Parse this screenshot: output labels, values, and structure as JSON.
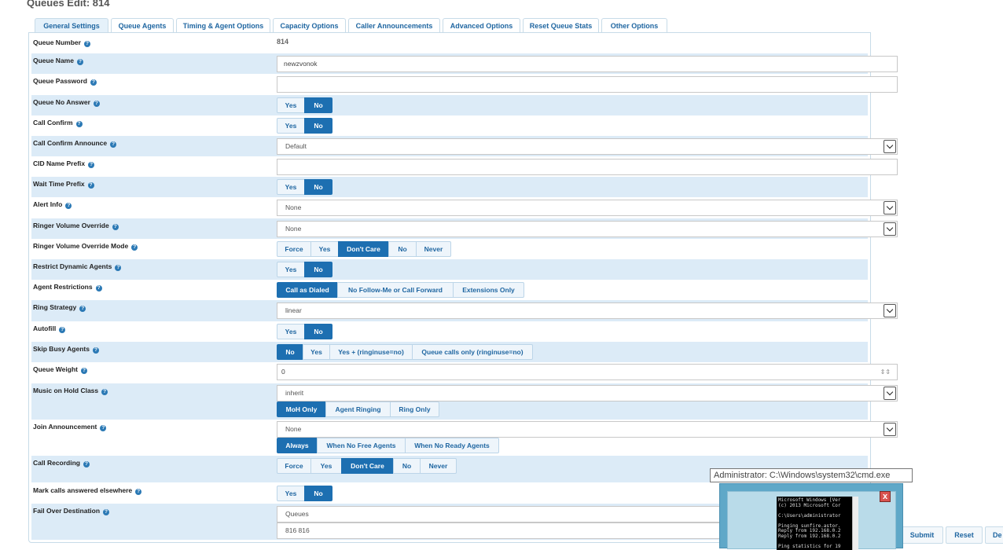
{
  "page": {
    "title": "Queues Edit: 814"
  },
  "tabs": [
    "General Settings",
    "Queue Agents",
    "Timing & Agent Options",
    "Capacity Options",
    "Caller Announcements",
    "Advanced Options",
    "Reset Queue Stats",
    "Other Options"
  ],
  "active_tab": "General Settings",
  "help_glyph": "?",
  "fields": {
    "queue_number": {
      "label": "Queue Number",
      "value": "814"
    },
    "queue_name": {
      "label": "Queue Name",
      "value": "newzvonok"
    },
    "queue_password": {
      "label": "Queue Password",
      "value": ""
    },
    "queue_no_answer": {
      "label": "Queue No Answer",
      "options": [
        "Yes",
        "No"
      ],
      "selected": "No"
    },
    "call_confirm": {
      "label": "Call Confirm",
      "options": [
        "Yes",
        "No"
      ],
      "selected": "No"
    },
    "call_confirm_announce": {
      "label": "Call Confirm Announce",
      "value": "Default"
    },
    "cid_name_prefix": {
      "label": "CID Name Prefix",
      "value": ""
    },
    "wait_time_prefix": {
      "label": "Wait Time Prefix",
      "options": [
        "Yes",
        "No"
      ],
      "selected": "No"
    },
    "alert_info": {
      "label": "Alert Info",
      "value": "None"
    },
    "ringer_volume_override": {
      "label": "Ringer Volume Override",
      "value": "None"
    },
    "ringer_volume_override_mode": {
      "label": "Ringer Volume Override Mode",
      "options": [
        "Force",
        "Yes",
        "Don't Care",
        "No",
        "Never"
      ],
      "selected": "Don't Care"
    },
    "restrict_dynamic_agents": {
      "label": "Restrict Dynamic Agents",
      "options": [
        "Yes",
        "No"
      ],
      "selected": "No"
    },
    "agent_restrictions": {
      "label": "Agent Restrictions",
      "options": [
        "Call as Dialed",
        "No Follow-Me or Call Forward",
        "Extensions Only"
      ],
      "selected": "Call as Dialed"
    },
    "ring_strategy": {
      "label": "Ring Strategy",
      "value": "linear"
    },
    "autofill": {
      "label": "Autofill",
      "options": [
        "Yes",
        "No"
      ],
      "selected": "No"
    },
    "skip_busy_agents": {
      "label": "Skip Busy Agents",
      "options": [
        "No",
        "Yes",
        "Yes + (ringinuse=no)",
        "Queue calls only (ringinuse=no)"
      ],
      "selected": "No"
    },
    "queue_weight": {
      "label": "Queue Weight",
      "value": "0",
      "spin_mark": "⇕⇕"
    },
    "music_on_hold_class": {
      "label": "Music on Hold Class",
      "value": "inherit",
      "options": [
        "MoH Only",
        "Agent Ringing",
        "Ring Only"
      ],
      "selected": "MoH Only"
    },
    "join_announcement": {
      "label": "Join Announcement",
      "value": "None",
      "options": [
        "Always",
        "When No Free Agents",
        "When No Ready Agents"
      ],
      "selected": "Always"
    },
    "call_recording": {
      "label": "Call Recording",
      "options": [
        "Force",
        "Yes",
        "Don't Care",
        "No",
        "Never"
      ],
      "selected": "Don't Care"
    },
    "mark_calls_answered_elsewhere": {
      "label": "Mark calls answered elsewhere",
      "options": [
        "Yes",
        "No"
      ],
      "selected": "No"
    },
    "fail_over_destination": {
      "label": "Fail Over Destination",
      "type_value": "Queues",
      "target_value": "816 816"
    }
  },
  "actions": {
    "submit": "Submit",
    "reset": "Reset",
    "delete_partial": "De"
  },
  "taskbar_preview": {
    "tooltip": "Administrator: C:\\Windows\\system32\\cmd.exe",
    "close_glyph": "x",
    "console_text": "Microsoft Windows [Ver\n(c) 2013 Microsoft Cor\n\nC:\\Users\\administrator\n\nPinging sunfire.astor.\nReply from 192.168.0.2\nReply from 192.168.0.2\n\nPing statistics for 19"
  }
}
